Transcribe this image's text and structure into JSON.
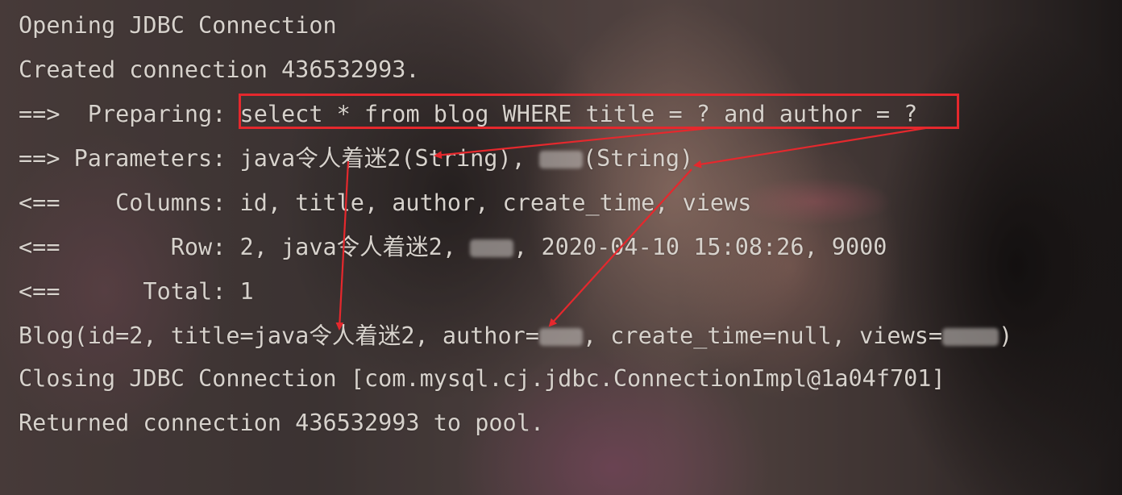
{
  "console": {
    "lines": [
      {
        "text": "Opening JDBC Connection"
      },
      {
        "text": "Created connection 436532993."
      },
      {
        "prefix": "==>  Preparing: ",
        "sql": "select * from blog WHERE title = ? and author = ?"
      },
      {
        "prefix": "==> Parameters: ",
        "param1_a": "java",
        "param1_cjk": "令人着迷",
        "param1_b": "2(String), ",
        "param2_suffix": "(String)"
      },
      {
        "text": "<==    Columns: id, title, author, create_time, views"
      },
      {
        "prefix": "<==        Row: 2, java",
        "cjk": "令人着迷",
        "mid": "2, ",
        "rest": ", 2020-04-10 15:08:26, 9000"
      },
      {
        "text": "<==      Total: 1"
      },
      {
        "a": "Blog(id=2, title=java",
        "cjk": "令人着迷",
        "b": "2, author=",
        "c": ", create_time=null, views=",
        "d": ")"
      },
      {
        "text": "Closing JDBC Connection [com.mysql.cj.jdbc.ConnectionImpl@1a04f701]"
      },
      {
        "text": "Returned connection 436532993 to pool."
      }
    ]
  },
  "colors": {
    "console_text": "#d7d2cc",
    "highlight_border": "#e5282d",
    "arrow": "#e5282d"
  }
}
